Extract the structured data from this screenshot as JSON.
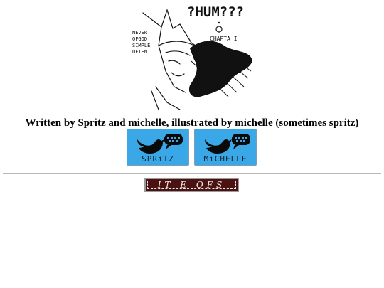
{
  "banner": {
    "bubble_text": "?HUM???",
    "chapter_text": "CHAPTA I",
    "side_text_lines": [
      "NEVER",
      "OFGOD",
      "SIMPLE",
      "OFTEN"
    ]
  },
  "credits": {
    "text": "Written by Spritz and michelle, illustrated by michelle (sometimes spritz)"
  },
  "social": [
    {
      "label": "SPRiTZ",
      "icon": "bird-icon"
    },
    {
      "label": "MiCHELLE",
      "icon": "bird-icon"
    }
  ],
  "archive": {
    "label": "IT E OFS"
  },
  "colors": {
    "twitter_blue": "#3aa8e6",
    "archive_bg": "#4a1210",
    "divider": "#b8b8b8"
  }
}
